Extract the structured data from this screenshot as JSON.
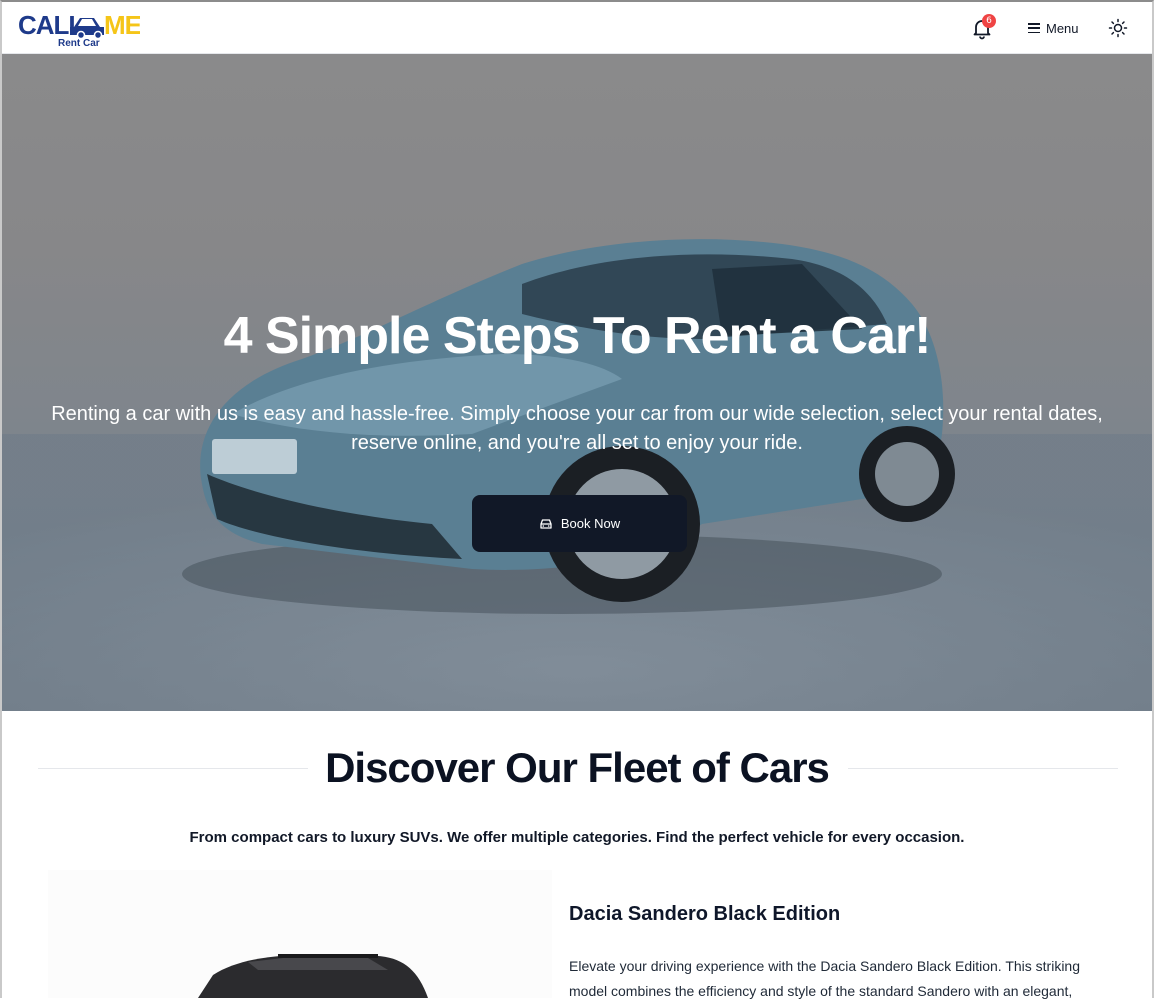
{
  "header": {
    "logo_text_main": "CALL ME",
    "logo_text_sub": "Rent Car",
    "notifications_count": "6",
    "menu_label": "Menu"
  },
  "hero": {
    "title": "4 Simple Steps To Rent a Car!",
    "text": "Renting a car with us is easy and hassle-free. Simply choose your car from our wide selection, select your rental dates, reserve online, and you're all set to enjoy your ride.",
    "cta_label": "Book Now"
  },
  "fleet": {
    "title": "Discover Our Fleet of Cars",
    "subtitle": "From compact cars to luxury SUVs. We offer multiple categories. Find the perfect vehicle for every occasion.",
    "featured_car": {
      "name": "Dacia Sandero Black Edition",
      "description": "Elevate your driving experience with the Dacia Sandero Black Edition. This striking model combines the efficiency and style of the standard Sandero with an elegant,"
    }
  },
  "colors": {
    "brand_blue": "#1e3a8a",
    "brand_yellow": "#f5c518",
    "dark": "#111827",
    "badge_red": "#ef4444"
  },
  "icons": [
    "bell-icon",
    "menu-icon",
    "sun-icon",
    "car-icon"
  ]
}
